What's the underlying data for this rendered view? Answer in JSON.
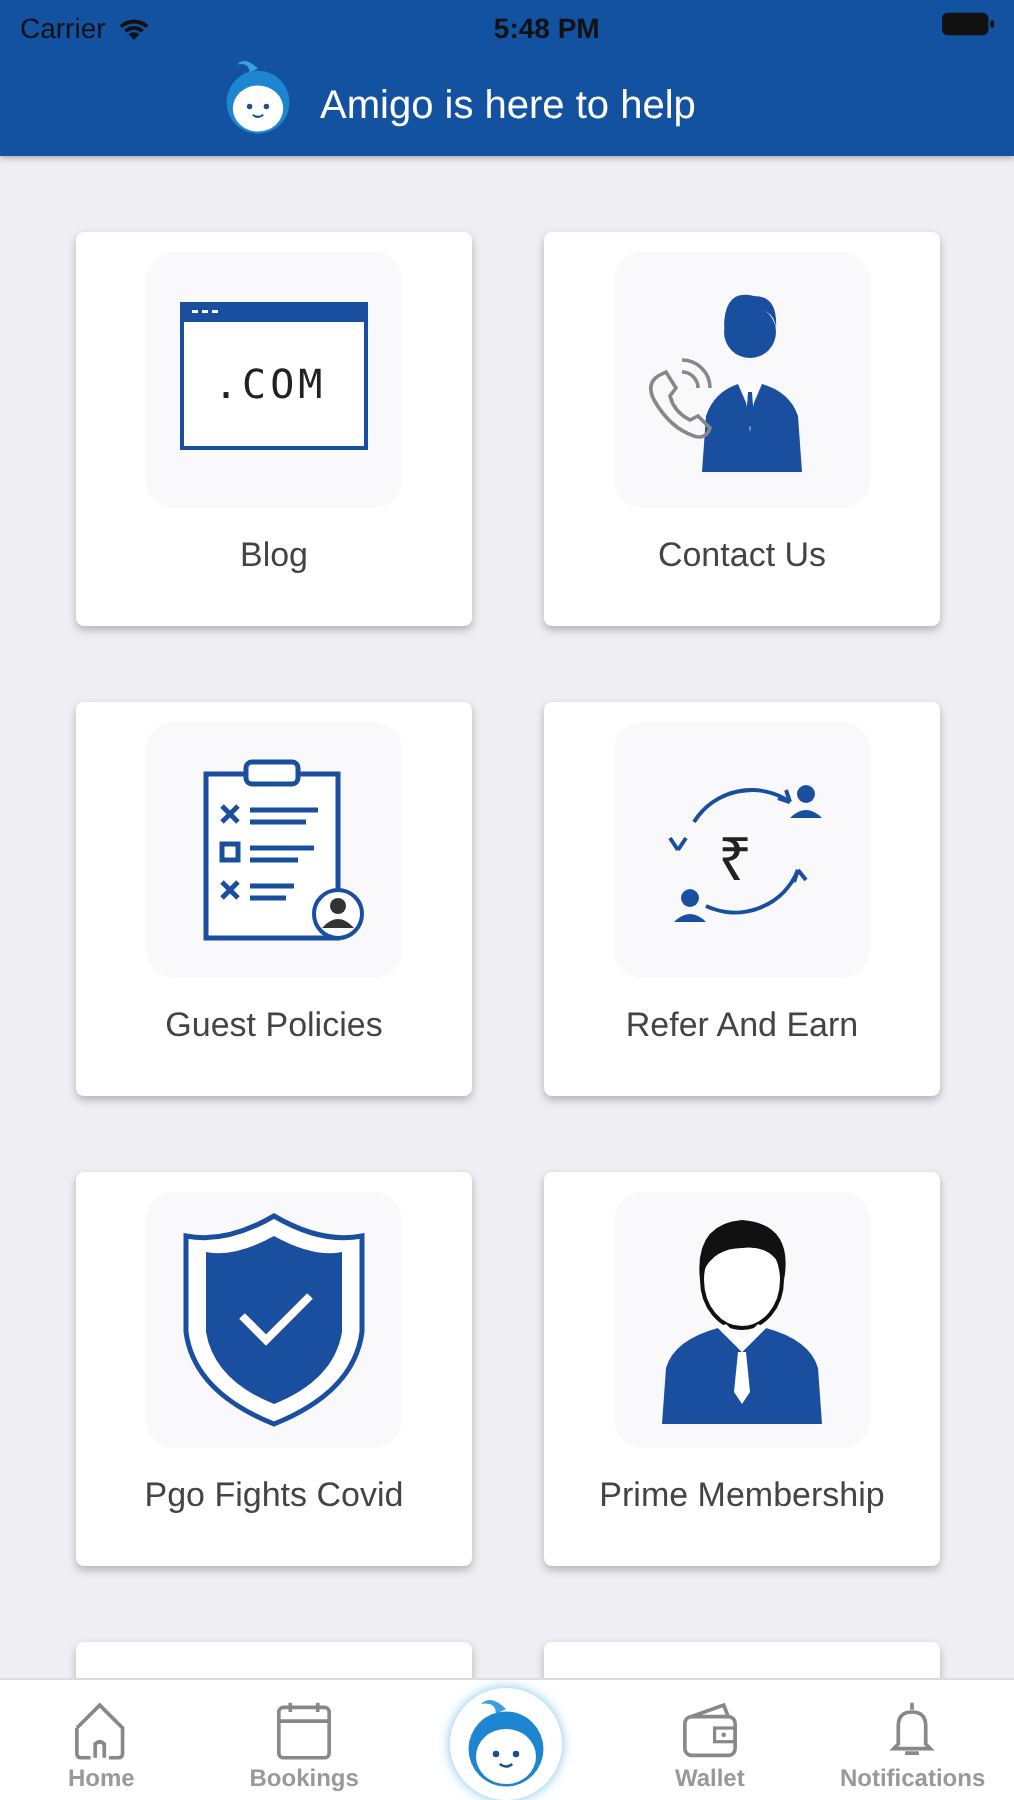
{
  "status_bar": {
    "carrier": "Carrier",
    "time": "5:48 PM"
  },
  "header": {
    "title": "Amigo is here to help"
  },
  "card_rows": [
    {
      "cards": [
        {
          "kind": "blog",
          "label": "Blog",
          "icon": {
            "text": ".COM"
          }
        },
        {
          "kind": "contact",
          "label": "Contact Us"
        }
      ]
    },
    {
      "cards": [
        {
          "kind": "policies",
          "label": "Guest Policies"
        },
        {
          "kind": "refer",
          "label": "Refer And Earn",
          "icon": {
            "text": "₹"
          }
        }
      ]
    },
    {
      "cards": [
        {
          "kind": "covid",
          "label": "Pgo Fights Covid"
        },
        {
          "kind": "prime",
          "label": "Prime Membership"
        }
      ]
    },
    {
      "cards": [
        {
          "kind": "cut_off"
        },
        {
          "kind": "cut_off"
        }
      ]
    }
  ],
  "tab_bar": [
    {
      "kind": "home",
      "label": "Home",
      "selected": false
    },
    {
      "kind": "bookings",
      "label": "Bookings",
      "selected": false
    },
    {
      "kind": "amigo",
      "selected": false
    },
    {
      "kind": "wallet",
      "label": "Wallet",
      "selected": false
    },
    {
      "kind": "notifications",
      "label": "Notifications",
      "selected": false
    }
  ]
}
